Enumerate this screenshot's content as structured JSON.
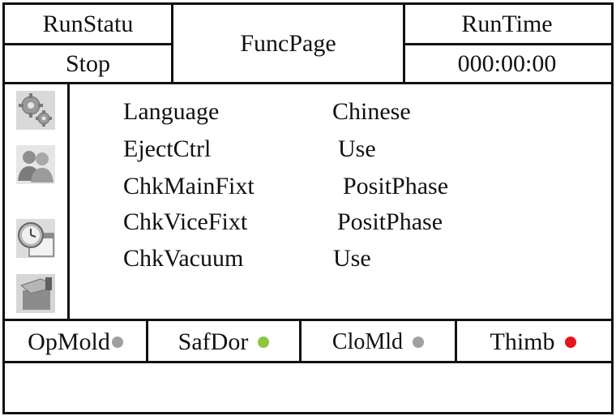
{
  "header": {
    "run_status_label": "RunStatu",
    "run_status_value": "Stop",
    "page_title": "FuncPage",
    "run_time_label": "RunTime",
    "run_time_value": "000:00:00"
  },
  "sidebar": {
    "icons": [
      "gear-icon",
      "users-icon",
      "clock-calendar-icon",
      "hand-tool-icon"
    ]
  },
  "settings": [
    {
      "label": "Language",
      "value": "Chinese"
    },
    {
      "label": "EjectCtrl",
      "value": "Use"
    },
    {
      "label": "ChkMainFixt",
      "value": "PositPhase"
    },
    {
      "label": "ChkViceFixt",
      "value": "PositPhase"
    },
    {
      "label": "ChkVacuum",
      "value": "Use"
    }
  ],
  "status_bar": [
    {
      "label": "OpMold",
      "color": "#a0a0a0"
    },
    {
      "label": "SafDor",
      "color": "#8cc63f"
    },
    {
      "label": "CloMld",
      "color": "#a0a0a0"
    },
    {
      "label": "Thimb",
      "color": "#e8141c"
    }
  ],
  "message_bar": {
    "text": ""
  }
}
